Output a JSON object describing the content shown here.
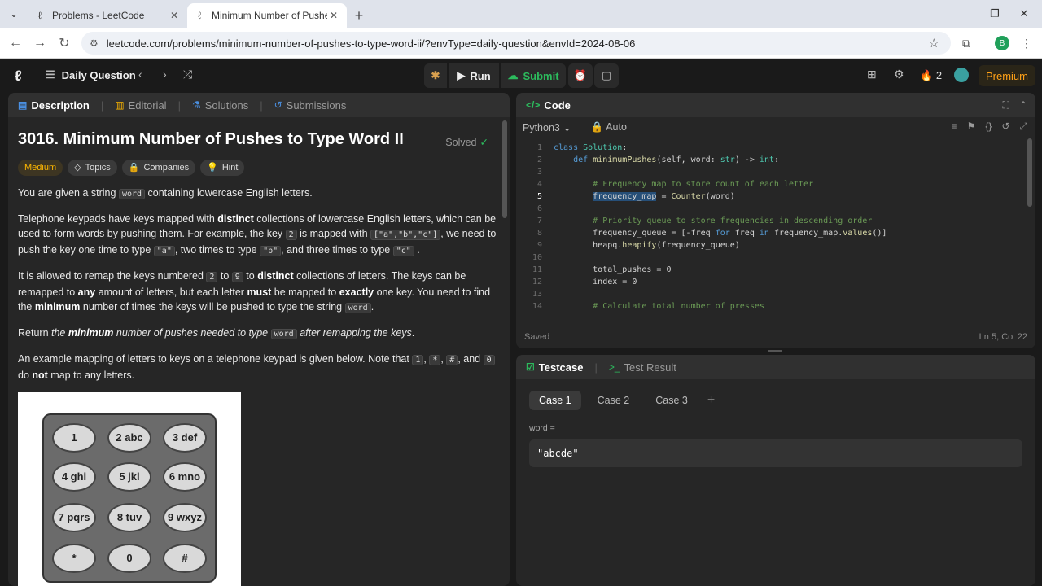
{
  "browser": {
    "tabs": [
      {
        "title": "Problems - LeetCode",
        "active": false
      },
      {
        "title": "Minimum Number of Pushes to",
        "active": true
      }
    ],
    "url": "leetcode.com/problems/minimum-number-of-pushes-to-type-word-ii/?envType=daily-question&envId=2024-08-06",
    "profile_initial": "B"
  },
  "nav": {
    "daily_question": "Daily Question",
    "run": "Run",
    "submit": "Submit",
    "streak": "2",
    "premium": "Premium"
  },
  "description": {
    "tabs": [
      "Description",
      "Editorial",
      "Solutions",
      "Submissions"
    ],
    "title": "3016. Minimum Number of Pushes to Type Word II",
    "solved": "Solved",
    "chips": [
      "Medium",
      "Topics",
      "Companies",
      "Hint"
    ],
    "p1a": "You are given a string ",
    "p1code": "word",
    "p1b": " containing lowercase English letters.",
    "p2a": "Telephone keypads have keys mapped with ",
    "p2b": "distinct",
    "p2c": " collections of lowercase English letters, which can be used to form words by pushing them. For example, the key ",
    "p2code1": "2",
    "p2d": " is mapped with ",
    "p2code2": "[\"a\",\"b\",\"c\"]",
    "p2e": ", we need to push the key one time to type ",
    "p2code3": "\"a\"",
    "p2f": ", two times to type ",
    "p2code4": "\"b\"",
    "p2g": ", and three times to type ",
    "p2code5": "\"c\"",
    "p2h": " .",
    "p3a": "It is allowed to remap the keys numbered ",
    "p3code1": "2",
    "p3b": " to ",
    "p3code2": "9",
    "p3c": " to ",
    "p3d": "distinct",
    "p3e": " collections of letters. The keys can be remapped to ",
    "p3f": "any",
    "p3g": " amount of letters, but each letter ",
    "p3h": "must",
    "p3i": " be mapped to ",
    "p3j": "exactly",
    "p3k": " one key. You need to find the ",
    "p3l": "minimum",
    "p3m": " number of times the keys will be pushed to type the string ",
    "p3code3": "word",
    "p3n": ".",
    "p4a": "Return ",
    "p4b": "the ",
    "p4c": "minimum",
    "p4d": " number of pushes needed to type ",
    "p4code": "word",
    "p4e": " after remapping the keys",
    "p4f": ".",
    "p5a": "An example mapping of letters to keys on a telephone keypad is given below. Note that ",
    "p5code1": "1",
    "p5code2": "*",
    "p5code3": "#",
    "p5code4": "0",
    "p5b": ", ",
    "p5c": ", ",
    "p5d": ", and ",
    "p5e": " do ",
    "p5f": "not",
    "p5g": " map to any letters.",
    "keys": [
      "1",
      "2 abc",
      "3 def",
      "4 ghi",
      "5 jkl",
      "6 mno",
      "7 pqrs",
      "8 tuv",
      "9 wxyz",
      "*",
      "0",
      "#"
    ]
  },
  "code": {
    "tab": "Code",
    "language": "Python3",
    "mode": "Auto",
    "lines": [
      {
        "n": "1",
        "t": "class Solution:"
      },
      {
        "n": "2",
        "t": "    def minimumPushes(self, word: str) -> int:"
      },
      {
        "n": "3",
        "t": ""
      },
      {
        "n": "4",
        "t": "        # Frequency map to store count of each letter"
      },
      {
        "n": "5",
        "t": "        frequency_map = Counter(word)"
      },
      {
        "n": "6",
        "t": ""
      },
      {
        "n": "7",
        "t": "        # Priority queue to store frequencies in descending order"
      },
      {
        "n": "8",
        "t": "        frequency_queue = [-freq for freq in frequency_map.values()]"
      },
      {
        "n": "9",
        "t": "        heapq.heapify(frequency_queue)"
      },
      {
        "n": "10",
        "t": ""
      },
      {
        "n": "11",
        "t": "        total_pushes = 0"
      },
      {
        "n": "12",
        "t": "        index = 0"
      },
      {
        "n": "13",
        "t": ""
      },
      {
        "n": "14",
        "t": "        # Calculate total number of presses"
      }
    ],
    "saved": "Saved",
    "cursor": "Ln 5, Col 22"
  },
  "tests": {
    "tabs": [
      "Testcase",
      "Test Result"
    ],
    "cases": [
      "Case 1",
      "Case 2",
      "Case 3"
    ],
    "var_label": "word =",
    "var_value": "\"abcde\""
  }
}
